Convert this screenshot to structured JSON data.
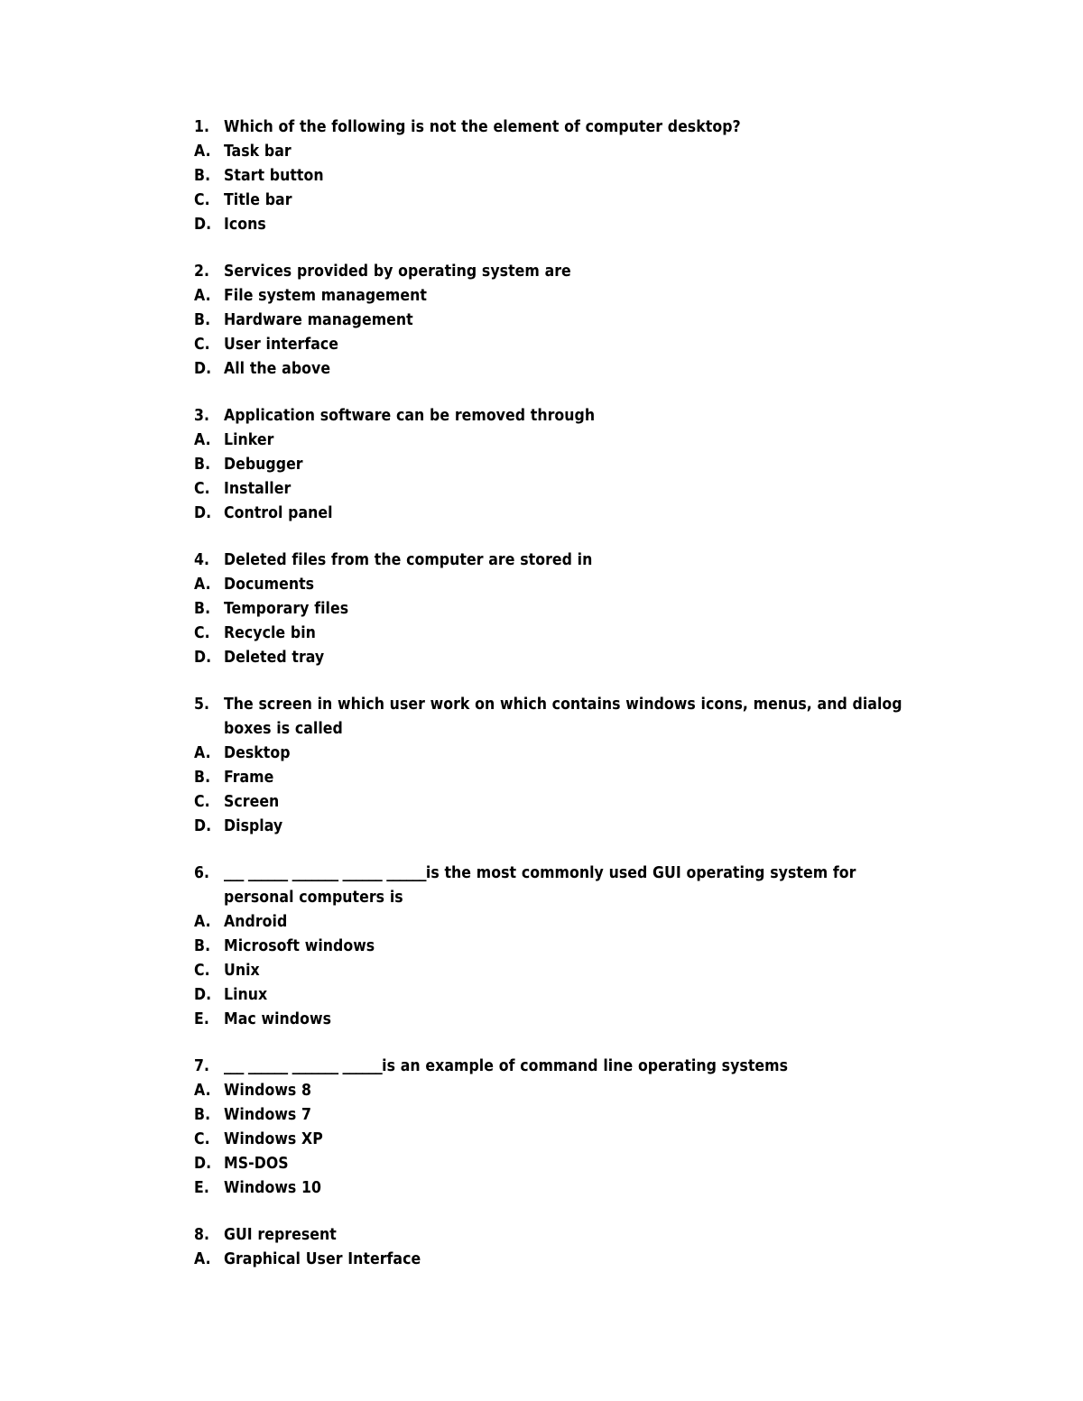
{
  "document": {
    "type": "multiple-choice-quiz",
    "subject": "Computer fundamentals / Operating systems",
    "text_color": "#000000",
    "background_color": "#ffffff",
    "questions": [
      {
        "number": "1.",
        "stem": "Which of the following is not the element of computer desktop?",
        "blank": "",
        "options": [
          {
            "marker": "A.",
            "text": "Task bar"
          },
          {
            "marker": "B.",
            "text": "Start button"
          },
          {
            "marker": "C.",
            "text": "Title bar"
          },
          {
            "marker": "D.",
            "text": "Icons"
          }
        ]
      },
      {
        "number": "2.",
        "stem": "Services provided by operating system are",
        "blank": "",
        "options": [
          {
            "marker": "A.",
            "text": "File system management"
          },
          {
            "marker": "B.",
            "text": "Hardware management"
          },
          {
            "marker": "C.",
            "text": "User interface"
          },
          {
            "marker": "D.",
            "text": "All the above"
          }
        ]
      },
      {
        "number": "3.",
        "stem": "Application software can be removed through",
        "blank": "",
        "options": [
          {
            "marker": "A.",
            "text": "Linker"
          },
          {
            "marker": "B.",
            "text": "Debugger"
          },
          {
            "marker": "C.",
            "text": "Installer"
          },
          {
            "marker": "D.",
            "text": "Control panel"
          }
        ]
      },
      {
        "number": "4.",
        "stem": "Deleted files from the computer are stored in",
        "blank": "",
        "options": [
          {
            "marker": "A.",
            "text": "Documents"
          },
          {
            "marker": "B.",
            "text": "Temporary files"
          },
          {
            "marker": "C.",
            "text": "Recycle bin"
          },
          {
            "marker": "D.",
            "text": "Deleted tray"
          }
        ]
      },
      {
        "number": "5.",
        "stem": "The screen in which user work on which contains windows icons, menus, and dialog boxes is called",
        "blank": "",
        "options": [
          {
            "marker": "A.",
            "text": "Desktop"
          },
          {
            "marker": "B.",
            "text": "Frame"
          },
          {
            "marker": "C.",
            "text": "Screen"
          },
          {
            "marker": "D.",
            "text": "Display"
          }
        ]
      },
      {
        "number": "6.",
        "stem": "is the most commonly used GUI operating system for personal computers is",
        "blank": "___ ______ _______ ______ ______",
        "options": [
          {
            "marker": "A.",
            "text": "Android"
          },
          {
            "marker": "B.",
            "text": "Microsoft windows"
          },
          {
            "marker": "C.",
            "text": "Unix"
          },
          {
            "marker": "D.",
            "text": "Linux"
          },
          {
            "marker": "E.",
            "text": "Mac windows"
          }
        ]
      },
      {
        "number": "7.",
        "stem": "is an example of command line operating systems",
        "blank": "___ ______ _______ ______",
        "options": [
          {
            "marker": "A.",
            "text": "Windows 8"
          },
          {
            "marker": "B.",
            "text": "Windows 7"
          },
          {
            "marker": "C.",
            "text": "Windows XP"
          },
          {
            "marker": "D.",
            "text": "MS-DOS"
          },
          {
            "marker": "E.",
            "text": "Windows 10"
          }
        ]
      },
      {
        "number": "8.",
        "stem": "GUI represent",
        "blank": "",
        "options": [
          {
            "marker": "A.",
            "text": "Graphical User Interface"
          }
        ]
      }
    ]
  }
}
